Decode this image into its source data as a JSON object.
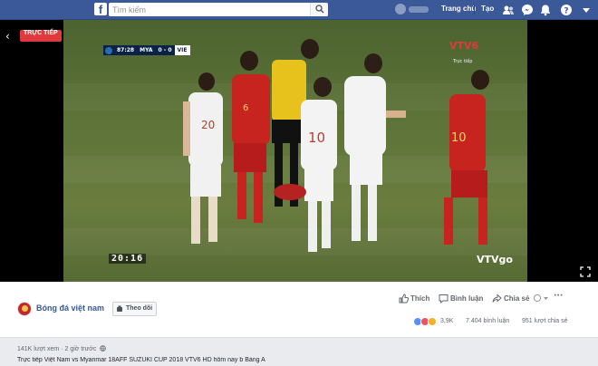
{
  "topbar": {
    "logo": "f",
    "search_placeholder": "Tìm kiếm",
    "nav_home": "Trang chủ",
    "nav_create": "Tạo",
    "icons": [
      "friend-requests-icon",
      "messenger-icon",
      "notifications-icon",
      "help-icon",
      "account-menu-icon"
    ],
    "brand_color": "#3b5998"
  },
  "video": {
    "live_label": "TRỰC TIẾP",
    "scoreboard": {
      "clock": "87:28",
      "home": "MYA",
      "score": "0 - 0",
      "away": "VIE"
    },
    "broadcaster": "VTV6",
    "broadcaster_sub": "Trực tiếp",
    "timecode": "20:16",
    "watermark": "VTVgo",
    "live_color": "#e0393e"
  },
  "panel": {
    "page_name": "Bóng đá việt nam",
    "follow_label": "Theo dõi",
    "actions": {
      "like": "Thích",
      "comment": "Bình luận",
      "share": "Chia sẻ"
    },
    "reactions_count": "3,9K",
    "comments_count": "7.404 bình luận",
    "shares_count": "951 lượt chia sẻ"
  },
  "meta": {
    "views": "141K lượt xem",
    "time": "2 giờ trước",
    "separator": "·",
    "description": "Trực tiếp Việt Nam vs Myanmar 18AFF SUZUKI CUP 2018 VTV6 HD hôm nay b Bảng A"
  }
}
